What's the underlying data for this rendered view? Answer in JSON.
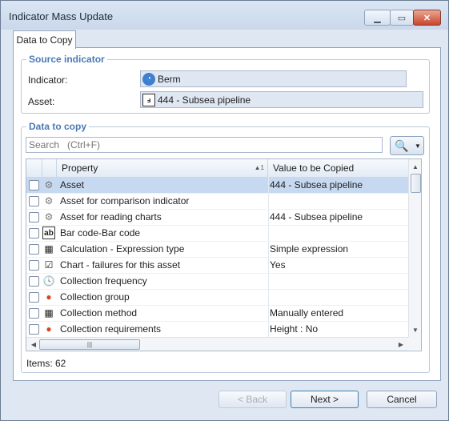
{
  "window": {
    "title": "Indicator Mass Update",
    "min_icon": "minimize-icon",
    "max_icon": "maximize-icon",
    "close_icon": "close-icon"
  },
  "tabs": [
    {
      "label": "Data to Copy",
      "active": true
    }
  ],
  "source": {
    "group_title": "Source indicator",
    "indicator_label": "Indicator:",
    "indicator_value": "Berm",
    "indicator_icon": "gauge-icon",
    "asset_label": "Asset:",
    "asset_value": "444 - Subsea pipeline",
    "asset_icon": "asset-icon"
  },
  "data_to_copy": {
    "group_title": "Data to copy",
    "search_placeholder": "Search   (Ctrl+F)",
    "search_icon": "magnifier-icon",
    "columns": {
      "property": "Property",
      "sort_indicator": "▲1",
      "value": "Value to be Copied"
    },
    "rows": [
      {
        "property": "Asset",
        "value": "444 - Subsea pipeline",
        "icon": "gear-icon",
        "selected": true
      },
      {
        "property": "Asset for comparison indicator",
        "value": "",
        "icon": "gear-icon",
        "selected": false
      },
      {
        "property": "Asset for reading charts",
        "value": "444 - Subsea pipeline",
        "icon": "gear-icon",
        "selected": false
      },
      {
        "property": "Bar code-Bar code",
        "value": "",
        "icon": "text-field-icon",
        "selected": false
      },
      {
        "property": "Calculation - Expression type",
        "value": "Simple expression",
        "icon": "calculator-icon",
        "selected": false
      },
      {
        "property": "Chart - failures for this asset",
        "value": "Yes",
        "icon": "checkbox-icon",
        "selected": false
      },
      {
        "property": "Collection frequency",
        "value": "",
        "icon": "calendar-clock-icon",
        "selected": false
      },
      {
        "property": "Collection group",
        "value": "",
        "icon": "group-icon",
        "selected": false
      },
      {
        "property": "Collection method",
        "value": "Manually entered",
        "icon": "calculator-icon",
        "selected": false
      },
      {
        "property": "Collection requirements",
        "value": "Height : No",
        "icon": "group-icon",
        "selected": false
      }
    ],
    "items_count": "Items: 62"
  },
  "buttons": {
    "back": "< Back",
    "next": "Next >",
    "cancel": "Cancel"
  }
}
